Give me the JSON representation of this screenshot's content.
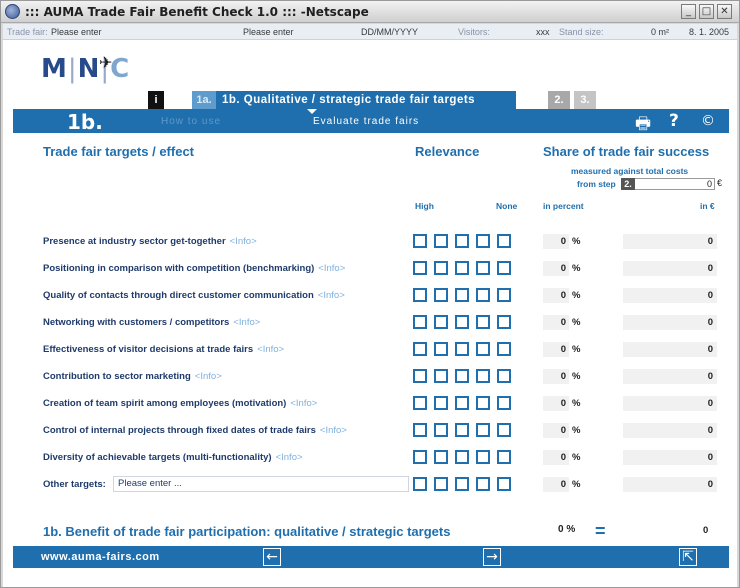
{
  "window": {
    "title": "::: AUMA Trade Fair Benefit Check 1.0 ::: -Netscape",
    "min_label": "_",
    "max_label": "□",
    "close_label": "✕"
  },
  "infobar": {
    "trade_fair_label": "Trade fair:",
    "trade_fair_value": "Please enter",
    "city_value": "Please enter",
    "date_placeholder": "DD/MM/YYYY",
    "visitors_label": "Visitors:",
    "visitors_value": "xxx",
    "stand_size_label": "Stand size:",
    "stand_size_value": "0 m²",
    "date": "8. 1. 2005"
  },
  "logo": {
    "m": "M",
    "n": "N",
    "c": "C",
    "mark": "✈"
  },
  "tabs": {
    "info": "i",
    "step_1a": "1a.",
    "active": "1b. Qualitative / strategic trade fair targets",
    "step_2": "2.",
    "step_3": "3."
  },
  "bluebar": {
    "step": "1b.",
    "how_to_use": "How to use",
    "evaluate": "Evaluate trade fairs",
    "print_icon": "🖶",
    "help_icon": "?",
    "copyright_icon": "©"
  },
  "columns": {
    "targets": "Trade fair targets / effect",
    "relevance": "Relevance",
    "share": "Share of trade fair success",
    "measured": "measured against total costs",
    "from_step": "from step",
    "step_num": "2.",
    "total_costs": "0",
    "euro": "€",
    "high": "High",
    "none": "None",
    "in_percent": "in percent",
    "in_euro": "in €"
  },
  "rows": [
    {
      "label": "Presence at industry sector get-together",
      "info": "<Info>",
      "percent": "0",
      "euro": "0"
    },
    {
      "label": "Positioning in comparison with competition (benchmarking)",
      "info": "<Info>",
      "percent": "0",
      "euro": "0"
    },
    {
      "label": "Quality of contacts through direct customer communication",
      "info": "<Info>",
      "percent": "0",
      "euro": "0"
    },
    {
      "label": "Networking with customers / competitors",
      "info": "<Info>",
      "percent": "0",
      "euro": "0"
    },
    {
      "label": "Effectiveness of visitor decisions at trade fairs",
      "info": "<Info>",
      "percent": "0",
      "euro": "0"
    },
    {
      "label": "Contribution to sector marketing",
      "info": "<Info>",
      "percent": "0",
      "euro": "0"
    },
    {
      "label": "Creation of team spirit among employees (motivation)",
      "info": "<Info>",
      "percent": "0",
      "euro": "0"
    },
    {
      "label": "Control of internal projects through fixed dates of trade fairs",
      "info": "<Info>",
      "percent": "0",
      "euro": "0"
    },
    {
      "label": "Diversity of achievable targets (multi-functionality)",
      "info": "<Info>",
      "percent": "0",
      "euro": "0"
    },
    {
      "label": "Other targets:",
      "input_value": "Please enter ...",
      "percent": "0",
      "euro": "0"
    }
  ],
  "percent_sign": "%",
  "benefit": {
    "title": "1b. Benefit of trade fair participation: qualitative / strategic targets",
    "percent": "0 %",
    "equals": "=",
    "euro": "0"
  },
  "footer": {
    "url": "www.auma-fairs.com",
    "back_icon": "←",
    "forward_icon": "→",
    "exit_icon": "⇱"
  },
  "colors": {
    "accent": "#1f6fae",
    "text": "#1f3b6b",
    "info_link": "#7fb0de"
  }
}
